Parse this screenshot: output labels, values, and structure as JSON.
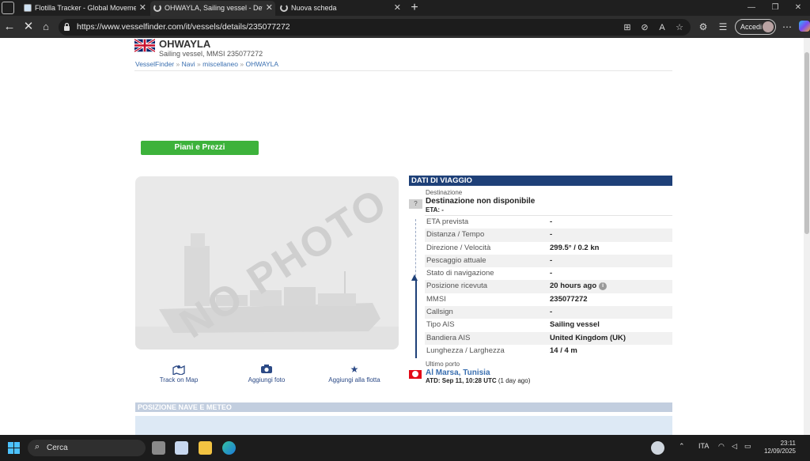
{
  "browser": {
    "tabs": [
      {
        "title": "Flotilla Tracker - Global Movemen",
        "active": false
      },
      {
        "title": "OHWAYLA, Sailing vessel - Dettag",
        "active": true
      },
      {
        "title": "Nuova scheda",
        "active": false
      }
    ],
    "url": "https://www.vesselfinder.com/it/vessels/details/235077272",
    "signin_label": "Accedi"
  },
  "vessel": {
    "name": "OHWAYLA",
    "subtitle": "Sailing vessel, MMSI 235077272",
    "breadcrumb": [
      "VesselFinder",
      "Navi",
      "miscellaneo",
      "OHWAYLA"
    ],
    "breadcrumb_sep": "»"
  },
  "plans_button": "Piani e Prezzi",
  "photo": {
    "placeholder": "NO PHOTO"
  },
  "actions": [
    {
      "label": "Track on Map",
      "icon": "map-pin-icon"
    },
    {
      "label": "Aggiungi foto",
      "icon": "camera-icon"
    },
    {
      "label": "Aggiungi alla flotta",
      "icon": "star-icon"
    }
  ],
  "voyage": {
    "header": "DATI DI VIAGGIO",
    "destination_label": "Destinazione",
    "destination_value": "Destinazione non disponibile",
    "eta": "ETA: -",
    "unknown_mark": "?",
    "rows": [
      {
        "k": "ETA prevista",
        "v": "-"
      },
      {
        "k": "Distanza / Tempo",
        "v": "-"
      },
      {
        "k": "Direzione / Velocità",
        "v": "299.5° / 0.2 kn"
      },
      {
        "k": "Pescaggio attuale",
        "v": "-"
      },
      {
        "k": "Stato di navigazione",
        "v": "-"
      },
      {
        "k": "Posizione ricevuta",
        "v": "20 hours ago"
      },
      {
        "k": "MMSI",
        "v": "235077272"
      },
      {
        "k": "Callsign",
        "v": "-"
      },
      {
        "k": "Tipo AIS",
        "v": "Sailing vessel"
      },
      {
        "k": "Bandiera AIS",
        "v": "United Kingdom (UK)"
      },
      {
        "k": "Lunghezza / Larghezza",
        "v": "14 / 4 m"
      }
    ],
    "last_port_label": "Ultimo porto",
    "last_port_name": "Al Marsa, Tunisia",
    "last_port_atd": "ATD: Sep 11, 10:28 UTC",
    "last_port_ago": "(1 day ago)"
  },
  "position_header": "POSIZIONE NAVE E METEO",
  "taskbar": {
    "search_placeholder": "Cerca",
    "language": "ITA",
    "time": "23:11",
    "date": "12/09/2025"
  }
}
